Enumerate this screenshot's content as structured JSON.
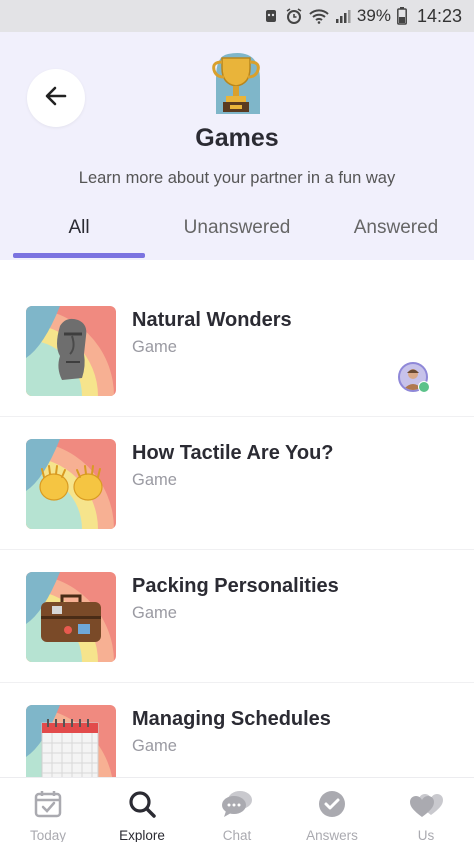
{
  "status_bar": {
    "battery": "39%",
    "time": "14:23"
  },
  "header": {
    "title": "Games",
    "subtitle": "Learn more about your partner in a fun way",
    "icon": "trophy-icon"
  },
  "tabs": [
    {
      "label": "All",
      "active": true
    },
    {
      "label": "Unanswered",
      "active": false
    },
    {
      "label": "Answered",
      "active": false
    }
  ],
  "games": [
    {
      "title": "Natural Wonders",
      "type": "Game",
      "icon": "moai-icon",
      "partner_answered": true
    },
    {
      "title": "How Tactile Are You?",
      "type": "Game",
      "icon": "open-hands-icon",
      "partner_answered": false
    },
    {
      "title": "Packing Personalities",
      "type": "Game",
      "icon": "suitcase-icon",
      "partner_answered": false
    },
    {
      "title": "Managing Schedules",
      "type": "Game",
      "icon": "calendar-icon",
      "partner_answered": false
    }
  ],
  "bottom_nav": [
    {
      "label": "Today",
      "icon": "calendar-check-icon",
      "active": false
    },
    {
      "label": "Explore",
      "icon": "search-icon",
      "active": true
    },
    {
      "label": "Chat",
      "icon": "chat-bubbles-icon",
      "active": false
    },
    {
      "label": "Answers",
      "icon": "check-circle-icon",
      "active": false
    },
    {
      "label": "Us",
      "icon": "hearts-icon",
      "active": false
    }
  ],
  "colors": {
    "accent": "#7b73e0",
    "header_bg": "#f1f0fc",
    "inactive": "#aaaab0"
  }
}
